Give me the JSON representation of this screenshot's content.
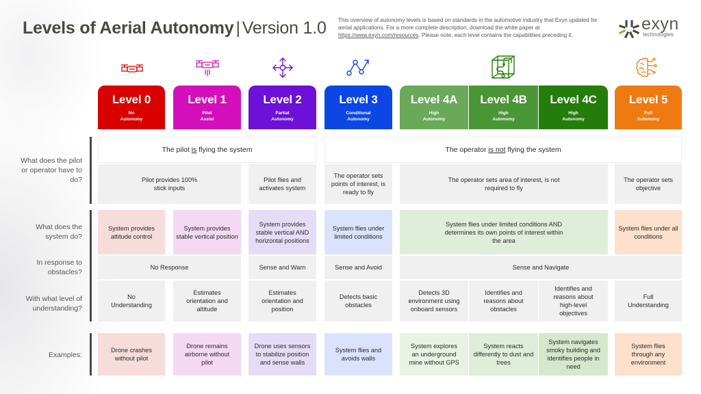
{
  "header": {
    "title": "Levels of Aerial Autonomy",
    "separator": "|",
    "version": "Version 1.0",
    "intro_text": "This overview of autonomy levels is based on standards in the automotive industry that Exyn updated for aerial applications. For a more complete description, download the white paper at",
    "intro_link": "https://www.exyn.com/resources",
    "intro_text_after": ". Please note, each level contains the capabilities preceding it.",
    "logo_word": "exyn",
    "logo_sub": "technologies"
  },
  "colors": {
    "level0": "#d90000",
    "level1": "#d20fbb",
    "level2": "#6d10d8",
    "level3": "#0c47e6",
    "level4a": "#6aa95a",
    "level4b": "#4a9636",
    "level4c": "#247d0a",
    "level5": "#ef7a12",
    "logo_green": "#7bc142",
    "logo_gray": "#4a4a45"
  },
  "levels": [
    {
      "id": "0",
      "label": "Level 0",
      "sub1": "No",
      "sub2": "Autonomy",
      "icon": "drone-icon"
    },
    {
      "id": "1",
      "label": "Level 1",
      "sub1": "Pilot",
      "sub2": "Assist",
      "icon": "drone-thrust-icon"
    },
    {
      "id": "2",
      "label": "Level 2",
      "sub1": "Partial",
      "sub2": "Autonomy",
      "icon": "move-arrows-icon"
    },
    {
      "id": "3",
      "label": "Level 3",
      "sub1": "Conditional",
      "sub2": "Autonomy",
      "icon": "waypoints-path-icon"
    },
    {
      "id": "4a",
      "label": "Level 4A",
      "sub1": "High",
      "sub2": "Autonomy",
      "icon": "cube-path-icon"
    },
    {
      "id": "4b",
      "label": "Level 4B",
      "sub1": "High",
      "sub2": "Autonomy"
    },
    {
      "id": "4c",
      "label": "Level 4C",
      "sub1": "High",
      "sub2": "Autonomy"
    },
    {
      "id": "5",
      "label": "Level 5",
      "sub1": "Full",
      "sub2": "Autonomy",
      "icon": "brain-circuit-icon"
    }
  ],
  "row_labels": {
    "pilot": "What does the pilot or operator have to do?",
    "system": "What does the system do?",
    "obstacles": "In response to obstacles?",
    "understanding": "With what level of understanding?",
    "examples": "Examples:"
  },
  "rows": {
    "flying": {
      "pilot_pre": "The pilot ",
      "pilot_emph": "is",
      "pilot_post": " flying the system",
      "operator_pre": "The operator ",
      "operator_emph": "is not",
      "operator_post": " flying the system"
    },
    "pilot_tasks": {
      "l0_l1": "Pilot provides 100% stick inputs",
      "l2": "Pilot flies and activates system",
      "l3": "The operator sets points of interest, is ready to fly",
      "l4": "The operator sets area of interest, is not required to fly",
      "l5": "The operator sets objective"
    },
    "system": {
      "l0": "System provides attitude control",
      "l1": "System provides stable vertical position",
      "l2": "System provides stable vertical AND horizontal positions",
      "l3": "System flies under limited conditions",
      "l4": "System flies under limited conditions AND determines its own points of interest within the area",
      "l5": "System flies under all conditions"
    },
    "obstacles": {
      "l0_l1": "No Response",
      "l2": "Sense and Warn",
      "l3": "Sense and Avoid",
      "l4_l5": "Sense and Navigate"
    },
    "understanding": {
      "l0": "No Understanding",
      "l1": "Estimates orientation and altitude",
      "l2": "Estimates orientation and position",
      "l3": "Detects basic obstacles",
      "l4a": "Detects 3D environment using onboard sensors",
      "l4b": "Identifies and reasons about obstacles",
      "l4c": "Identifies and reasons about high-level objectives",
      "l5": "Full Understanding"
    },
    "examples": {
      "l0": "Drone crashes without pilot",
      "l1": "Drone remains airborne without pilot",
      "l2": "Drone uses sensors to stabilize position and sense walls",
      "l3": "System flies and avoids walls",
      "l4a": "System explores an underground mine without GPS",
      "l4b": "System reacts differently to dust and trees",
      "l4c": "System navigates smoky building and identifies people in need",
      "l5": "System flies through any environment"
    }
  }
}
